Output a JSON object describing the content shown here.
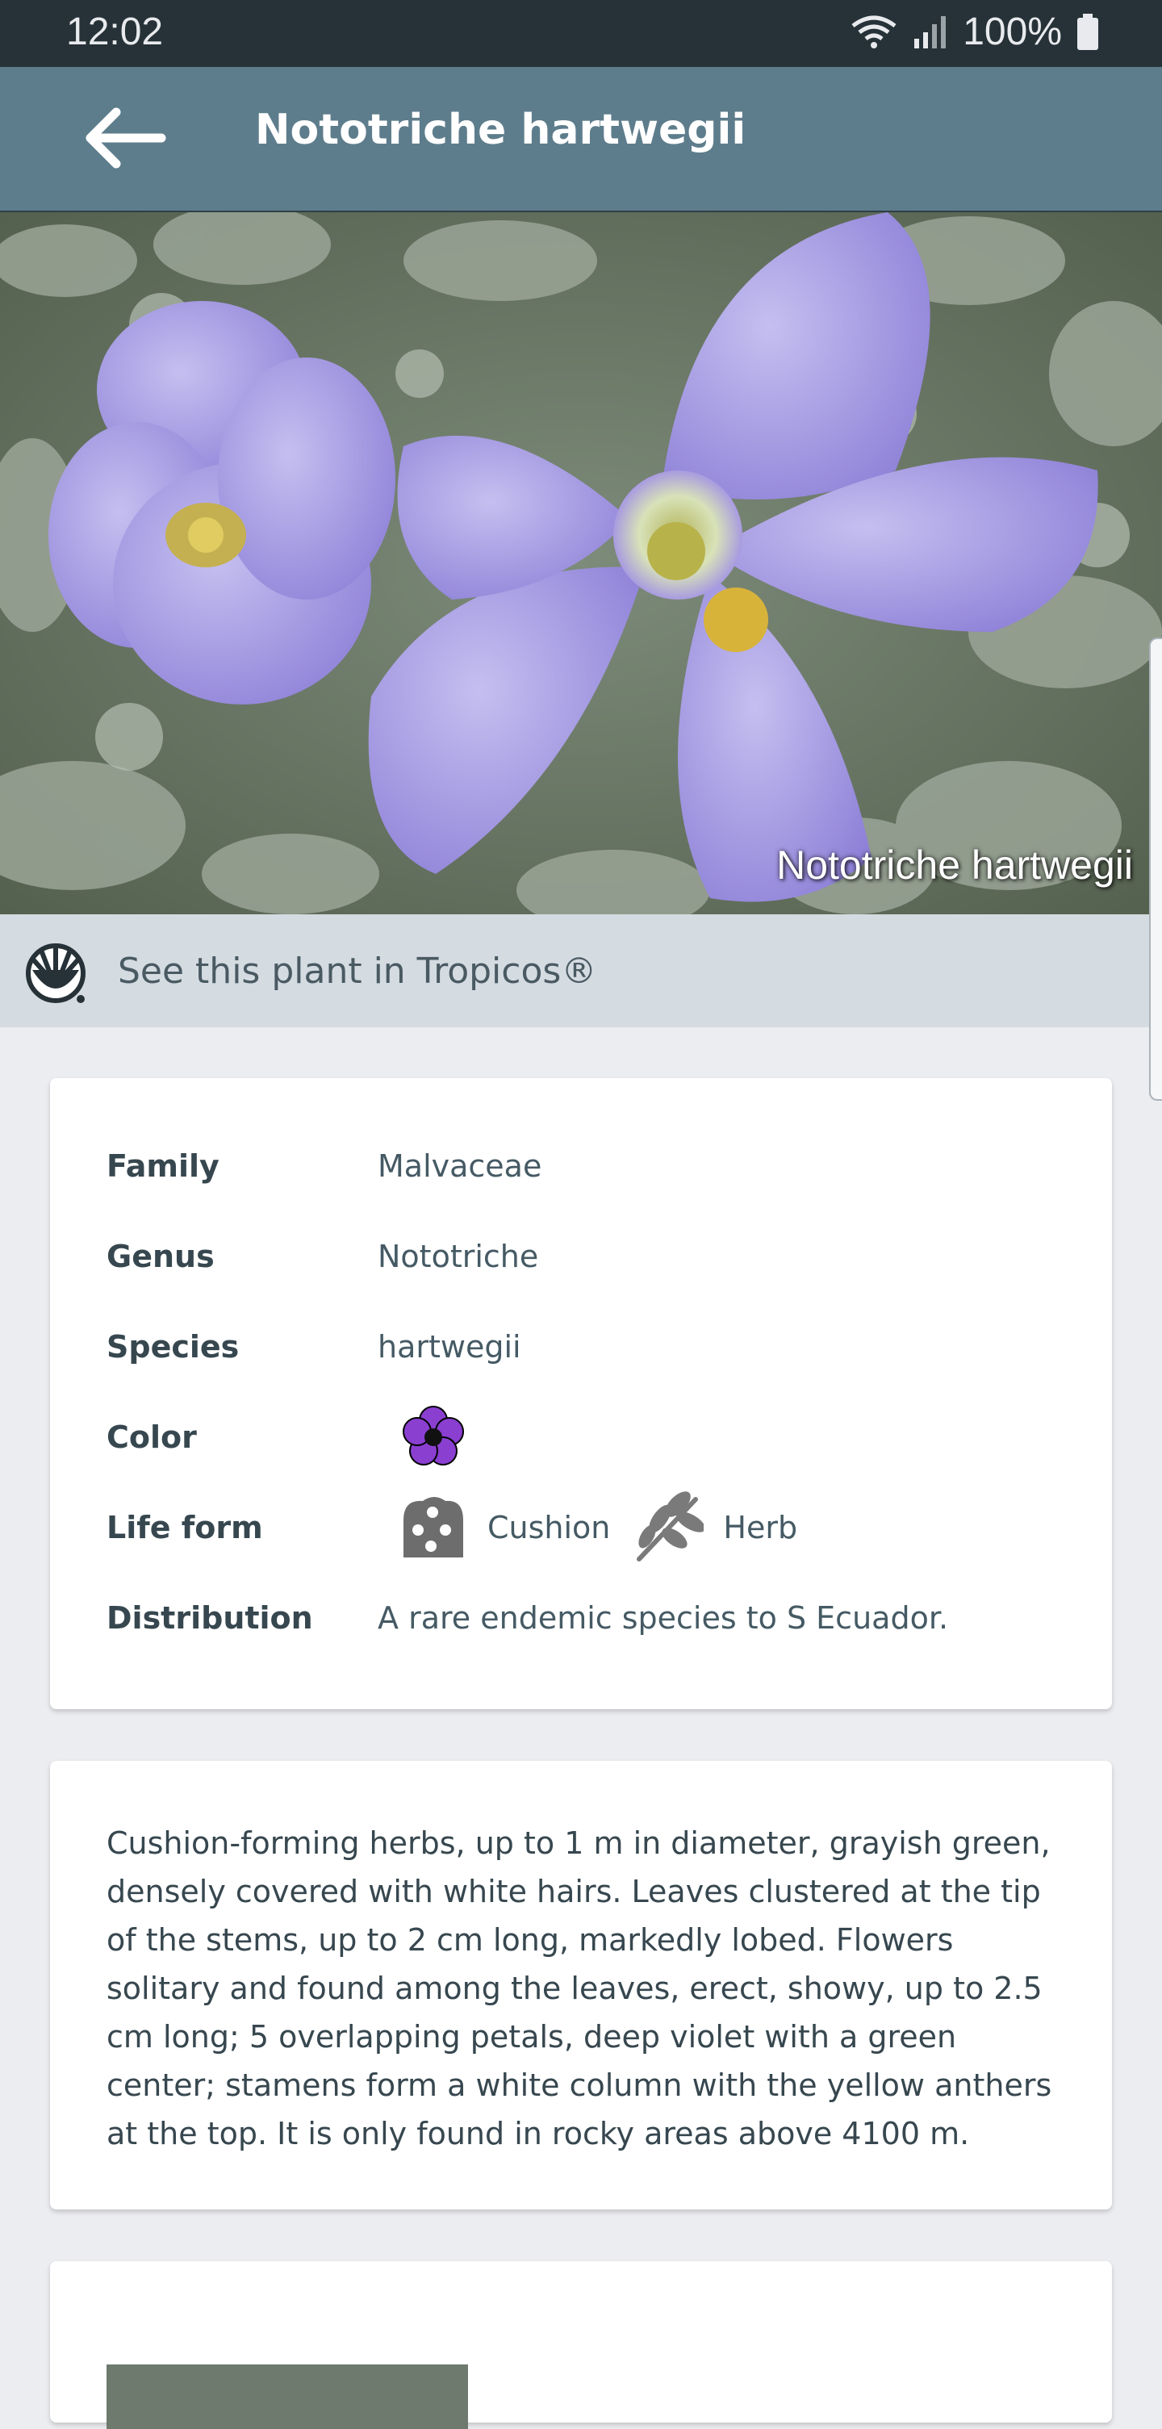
{
  "status_bar": {
    "time": "12:02",
    "battery": "100%",
    "icons": [
      "wifi-icon",
      "signal-icon",
      "battery-icon"
    ]
  },
  "app_bar": {
    "title": "Nototriche hartwegii",
    "back_icon": "arrow-left-icon"
  },
  "hero": {
    "caption": "Nototriche hartwegii"
  },
  "tropicos": {
    "label": "See this plant in Tropicos®",
    "icon": "tropicos-logo-icon"
  },
  "details": {
    "family": {
      "label": "Family",
      "value": "Malvaceae"
    },
    "genus": {
      "label": "Genus",
      "value": "Nototriche"
    },
    "species": {
      "label": "Species",
      "value": "hartwegii"
    },
    "color": {
      "label": "Color",
      "icon": "purple-flower-icon",
      "swatch": "#8a3fd1"
    },
    "life_form": {
      "label": "Life form",
      "items": [
        {
          "icon": "cushion-icon",
          "text": "Cushion"
        },
        {
          "icon": "herb-icon",
          "text": "Herb"
        }
      ]
    },
    "distribution": {
      "label": "Distribution",
      "value": "A rare endemic species to S Ecuador."
    }
  },
  "description": "Cushion-forming herbs, up to 1 m in diameter, grayish green, densely covered with white hairs. Leaves clustered at the tip of the stems, up to 2 cm long, markedly lobed. Flowers solitary and found among the leaves, erect, showy, up to 2.5 cm long; 5 overlapping petals, deep violet with a green center; stamens form a white column with the yellow anthers at the top. It is only found in rocky areas above 4100 m.",
  "colors": {
    "status_bar": "#263238",
    "app_bar": "#5e7d8c",
    "tropicos_bar": "#d4dbe1",
    "background": "#ecedf0"
  }
}
